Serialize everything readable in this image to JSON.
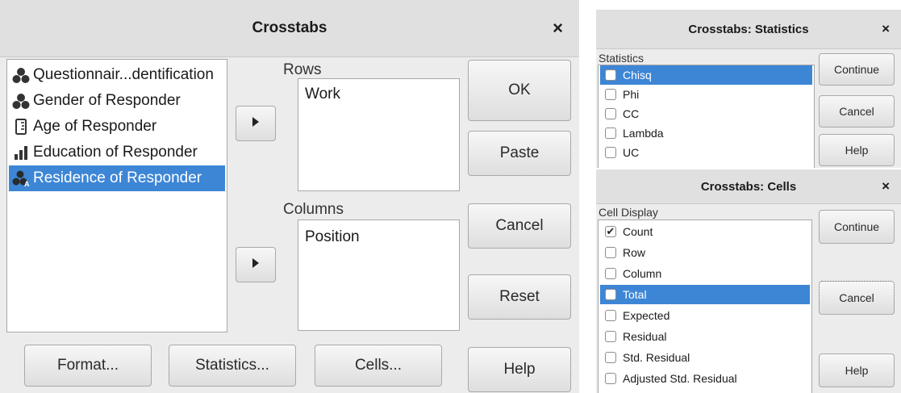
{
  "main": {
    "title": "Crosstabs",
    "variables": [
      {
        "label": "Questionnair...dentification",
        "icon": "nominal-icon",
        "selected": false
      },
      {
        "label": "Gender of Responder",
        "icon": "nominal-icon",
        "selected": false
      },
      {
        "label": "Age of Responder",
        "icon": "scale-ruler-icon",
        "selected": false
      },
      {
        "label": "Education of Responder",
        "icon": "ordinal-bars-icon",
        "selected": false
      },
      {
        "label": "Residence of Responder",
        "icon": "nominal-string-icon",
        "selected": true
      }
    ],
    "rows_label": "Rows",
    "rows_items": [
      "Work"
    ],
    "columns_label": "Columns",
    "columns_items": [
      "Position"
    ],
    "buttons": {
      "ok": "OK",
      "paste": "Paste",
      "cancel": "Cancel",
      "reset": "Reset",
      "help": "Help"
    },
    "bottom_buttons": {
      "format": "Format...",
      "statistics": "Statistics...",
      "cells": "Cells..."
    }
  },
  "statistics_dialog": {
    "title": "Crosstabs: Statistics",
    "group_label": "Statistics",
    "options": [
      {
        "label": "Chisq",
        "checked": false,
        "selected": true
      },
      {
        "label": "Phi",
        "checked": false,
        "selected": false
      },
      {
        "label": "CC",
        "checked": false,
        "selected": false
      },
      {
        "label": "Lambda",
        "checked": false,
        "selected": false
      },
      {
        "label": "UC",
        "checked": false,
        "selected": false
      }
    ],
    "buttons": {
      "continue": "Continue",
      "cancel": "Cancel",
      "help": "Help"
    }
  },
  "cells_dialog": {
    "title": "Crosstabs: Cells",
    "group_label": "Cell Display",
    "options": [
      {
        "label": "Count",
        "checked": true,
        "selected": false
      },
      {
        "label": "Row",
        "checked": false,
        "selected": false
      },
      {
        "label": "Column",
        "checked": false,
        "selected": false
      },
      {
        "label": "Total",
        "checked": false,
        "selected": true
      },
      {
        "label": "Expected",
        "checked": false,
        "selected": false
      },
      {
        "label": "Residual",
        "checked": false,
        "selected": false
      },
      {
        "label": "Std. Residual",
        "checked": false,
        "selected": false
      },
      {
        "label": "Adjusted Std. Residual",
        "checked": false,
        "selected": false
      }
    ],
    "buttons": {
      "continue": "Continue",
      "cancel": "Cancel",
      "help": "Help"
    }
  },
  "glyphs": {
    "close": "×",
    "check": "✔"
  },
  "colors": {
    "selection": "#3d86d6",
    "dialog_bg": "#ececec",
    "title_bg": "#e0e0e0"
  }
}
